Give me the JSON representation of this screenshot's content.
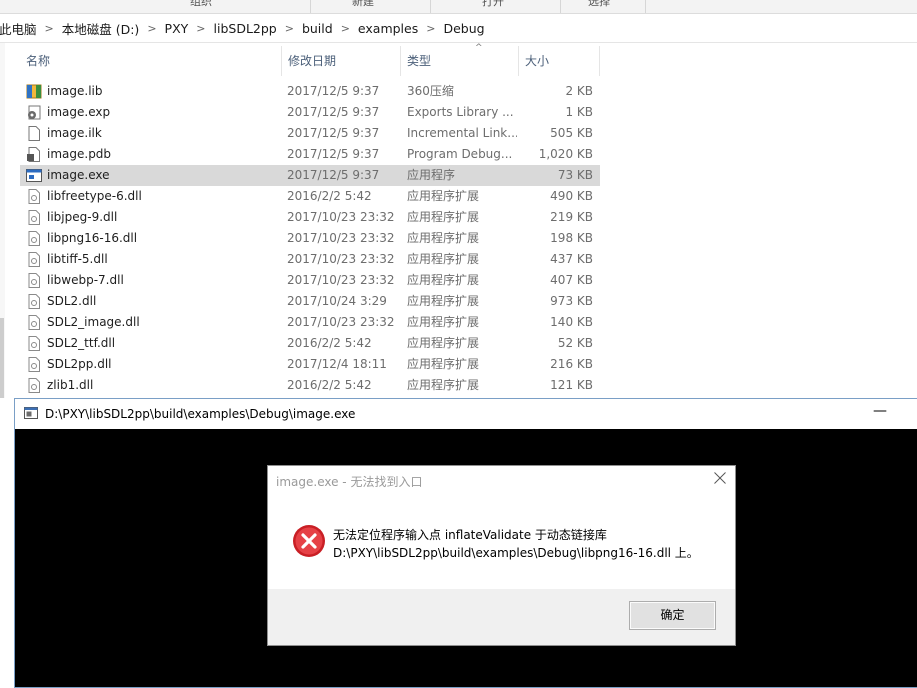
{
  "ribbon": {
    "groups": [
      "组织",
      "新建",
      "打开",
      "选择"
    ]
  },
  "breadcrumb": [
    "此电脑",
    "本地磁盘 (D:)",
    "PXY",
    "libSDL2pp",
    "build",
    "examples",
    "Debug"
  ],
  "columns": {
    "name": "名称",
    "date": "修改日期",
    "type": "类型",
    "size": "大小"
  },
  "files": [
    {
      "icon": "archive-file-icon",
      "name": "image.lib",
      "date": "2017/12/5 9:37",
      "type": "360压缩",
      "size": "2 KB"
    },
    {
      "icon": "gear-file-icon",
      "name": "image.exp",
      "date": "2017/12/5 9:37",
      "type": "Exports Library ...",
      "size": "1 KB"
    },
    {
      "icon": "blank-file-icon",
      "name": "image.ilk",
      "date": "2017/12/5 9:37",
      "type": "Incremental Link...",
      "size": "505 KB"
    },
    {
      "icon": "debug-file-icon",
      "name": "image.pdb",
      "date": "2017/12/5 9:37",
      "type": "Program Debug...",
      "size": "1,020 KB"
    },
    {
      "icon": "executable-file-icon",
      "name": "image.exe",
      "date": "2017/12/5 9:37",
      "type": "应用程序",
      "size": "73 KB",
      "selected": true
    },
    {
      "icon": "dll-file-icon",
      "name": "libfreetype-6.dll",
      "date": "2016/2/2 5:42",
      "type": "应用程序扩展",
      "size": "490 KB"
    },
    {
      "icon": "dll-file-icon",
      "name": "libjpeg-9.dll",
      "date": "2017/10/23 23:32",
      "type": "应用程序扩展",
      "size": "219 KB"
    },
    {
      "icon": "dll-file-icon",
      "name": "libpng16-16.dll",
      "date": "2017/10/23 23:32",
      "type": "应用程序扩展",
      "size": "198 KB"
    },
    {
      "icon": "dll-file-icon",
      "name": "libtiff-5.dll",
      "date": "2017/10/23 23:32",
      "type": "应用程序扩展",
      "size": "437 KB"
    },
    {
      "icon": "dll-file-icon",
      "name": "libwebp-7.dll",
      "date": "2017/10/23 23:32",
      "type": "应用程序扩展",
      "size": "407 KB"
    },
    {
      "icon": "dll-file-icon",
      "name": "SDL2.dll",
      "date": "2017/10/24 3:29",
      "type": "应用程序扩展",
      "size": "973 KB"
    },
    {
      "icon": "dll-file-icon",
      "name": "SDL2_image.dll",
      "date": "2017/10/23 23:32",
      "type": "应用程序扩展",
      "size": "140 KB"
    },
    {
      "icon": "dll-file-icon",
      "name": "SDL2_ttf.dll",
      "date": "2016/2/2 5:42",
      "type": "应用程序扩展",
      "size": "52 KB"
    },
    {
      "icon": "dll-file-icon",
      "name": "SDL2pp.dll",
      "date": "2017/12/4 18:11",
      "type": "应用程序扩展",
      "size": "216 KB"
    },
    {
      "icon": "dll-file-icon",
      "name": "zlib1.dll",
      "date": "2016/2/2 5:42",
      "type": "应用程序扩展",
      "size": "121 KB"
    }
  ],
  "console": {
    "title": "D:\\PXY\\libSDL2pp\\build\\examples\\Debug\\image.exe",
    "minimize_glyph": "—"
  },
  "dialog": {
    "title": "image.exe - 无法找到入口",
    "message_line1": "无法定位程序输入点 inflateValidate 于动态链接库",
    "message_line2": "D:\\PXY\\libSDL2pp\\build\\examples\\Debug\\libpng16-16.dll 上。",
    "ok_label": "确定"
  },
  "colors": {
    "selection": "#d9d9d9",
    "header_text": "#4c607a",
    "error_red": "#d3262a",
    "console_bg": "#000000"
  }
}
